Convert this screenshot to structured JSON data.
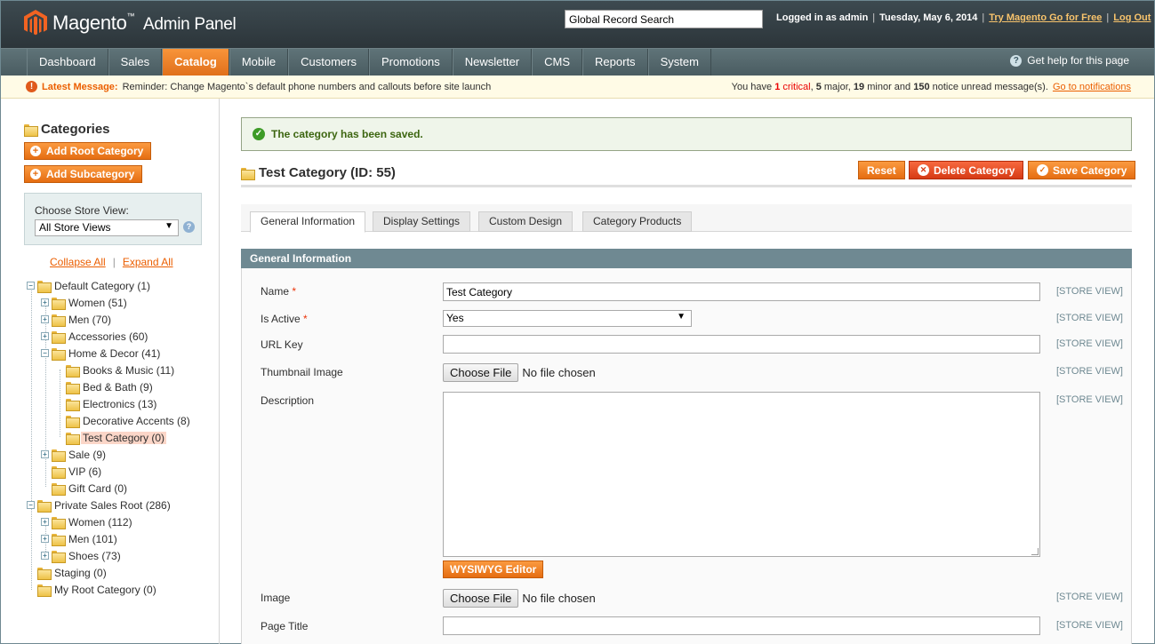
{
  "header": {
    "logo_name": "Magento",
    "logo_tm": "™",
    "logo_suffix": "Admin Panel",
    "search_value": "Global Record Search",
    "logged_in": "Logged in as admin",
    "date": "Tuesday, May 6, 2014",
    "try_go": "Try Magento Go for Free",
    "logout": "Log Out",
    "sep": "|"
  },
  "nav": {
    "items": [
      "Dashboard",
      "Sales",
      "Catalog",
      "Mobile",
      "Customers",
      "Promotions",
      "Newsletter",
      "CMS",
      "Reports",
      "System"
    ],
    "active": "Catalog",
    "help": "Get help for this page",
    "help_glyph": "?"
  },
  "messages": {
    "label": "Latest Message:",
    "text": "Reminder: Change Magento`s default phone numbers and callouts before site launch",
    "summary_pre": "You have",
    "critical_count": "1",
    "critical_label": "critical",
    "major_count": "5",
    "major_label": "major",
    "minor_count": "19",
    "minor_label": "minor and",
    "notice_count": "150",
    "notice_label": "notice unread message(s).",
    "link": "Go to notifications",
    "err_glyph": "!"
  },
  "sidebar": {
    "title": "Categories",
    "add_root": "Add Root Category",
    "add_sub": "Add Subcategory",
    "plus_glyph": "+",
    "store_label": "Choose Store View:",
    "store_value": "All Store Views",
    "select_arrow": "▼",
    "q_glyph": "?",
    "collapse_all": "Collapse All",
    "expand_all": "Expand All",
    "bar": "|",
    "tree": [
      {
        "label": "Default Category (1)",
        "level": 0,
        "exp": "minus"
      },
      {
        "label": "Women (51)",
        "level": 1,
        "exp": "plus"
      },
      {
        "label": "Men (70)",
        "level": 1,
        "exp": "plus"
      },
      {
        "label": "Accessories (60)",
        "level": 1,
        "exp": "plus"
      },
      {
        "label": "Home & Decor (41)",
        "level": 1,
        "exp": "minus"
      },
      {
        "label": "Books & Music (11)",
        "level": 2,
        "exp": "none"
      },
      {
        "label": "Bed & Bath (9)",
        "level": 2,
        "exp": "none"
      },
      {
        "label": "Electronics (13)",
        "level": 2,
        "exp": "none"
      },
      {
        "label": "Decorative Accents (8)",
        "level": 2,
        "exp": "none"
      },
      {
        "label": "Test Category (0)",
        "level": 2,
        "exp": "none",
        "selected": true
      },
      {
        "label": "Sale (9)",
        "level": 1,
        "exp": "plus"
      },
      {
        "label": "VIP (6)",
        "level": 1,
        "exp": "none"
      },
      {
        "label": "Gift Card (0)",
        "level": 1,
        "exp": "none"
      },
      {
        "label": "Private Sales Root (286)",
        "level": 0,
        "exp": "minus"
      },
      {
        "label": "Women (112)",
        "level": 1,
        "exp": "plus"
      },
      {
        "label": "Men (101)",
        "level": 1,
        "exp": "plus"
      },
      {
        "label": "Shoes (73)",
        "level": 1,
        "exp": "plus"
      },
      {
        "label": "Staging (0)",
        "level": 0,
        "exp": "none"
      },
      {
        "label": "My Root Category (0)",
        "level": 0,
        "exp": "none"
      }
    ]
  },
  "main": {
    "success": "The category has been saved.",
    "ok_glyph": "✓",
    "title": "Test Category (ID: 55)",
    "reset": "Reset",
    "delete": "Delete Category",
    "save": "Save Category",
    "x_glyph": "✕",
    "tabs": [
      "General Information",
      "Display Settings",
      "Custom Design",
      "Category Products"
    ],
    "active_tab": "General Information",
    "section": "General Information",
    "scope": "[STORE VIEW]",
    "req": "*",
    "fields": {
      "name_label": "Name",
      "name_value": "Test Category",
      "active_label": "Is Active",
      "active_value": "Yes",
      "url_label": "URL Key",
      "url_value": "",
      "thumb_label": "Thumbnail Image",
      "desc_label": "Description",
      "image_label": "Image",
      "page_title_label": "Page Title",
      "choose_file": "Choose File",
      "no_file": "No file chosen",
      "wysiwyg": "WYSIWYG Editor"
    }
  },
  "colors": {
    "accent": "#eb5e00",
    "header_bg": "#2c353a",
    "section_head": "#6f8992"
  }
}
